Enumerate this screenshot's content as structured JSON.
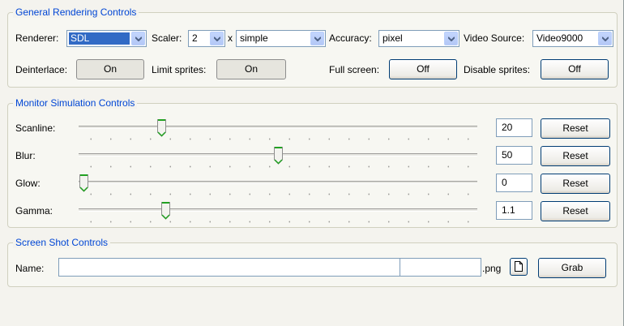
{
  "general": {
    "title": "General Rendering Controls",
    "renderer_label": "Renderer:",
    "renderer_value": "SDL",
    "scaler_label": "Scaler:",
    "scaler_value": "2",
    "scaler_x": "x",
    "scaler_mode": "simple",
    "accuracy_label": "Accuracy:",
    "accuracy_value": "pixel",
    "video_source_label": "Video Source:",
    "video_source_value": "Video9000",
    "deinterlace_label": "Deinterlace:",
    "deinterlace_value": "On",
    "limit_sprites_label": "Limit sprites:",
    "limit_sprites_value": "On",
    "full_screen_label": "Full screen:",
    "full_screen_value": "Off",
    "disable_sprites_label": "Disable sprites:",
    "disable_sprites_value": "Off"
  },
  "monitor": {
    "title": "Monitor Simulation Controls",
    "reset_label": "Reset",
    "sliders": [
      {
        "label": "Scanline:",
        "value": "20",
        "level": 20
      },
      {
        "label": "Blur:",
        "value": "50",
        "level": 50
      },
      {
        "label": "Glow:",
        "value": "0",
        "level": 0
      },
      {
        "label": "Gamma:",
        "value": "1.1",
        "level": 21
      }
    ]
  },
  "screenshot": {
    "title": "Screen Shot Controls",
    "name_label": "Name:",
    "name_value": "",
    "number_value": "",
    "extension": ".png",
    "grab_label": "Grab"
  },
  "icons": {
    "dropdown": "chevron-down-icon",
    "browse": "document-icon"
  },
  "colors": {
    "group_title": "#0046d5",
    "selection": "#316ac5",
    "slider_thumb": "#21a121"
  }
}
